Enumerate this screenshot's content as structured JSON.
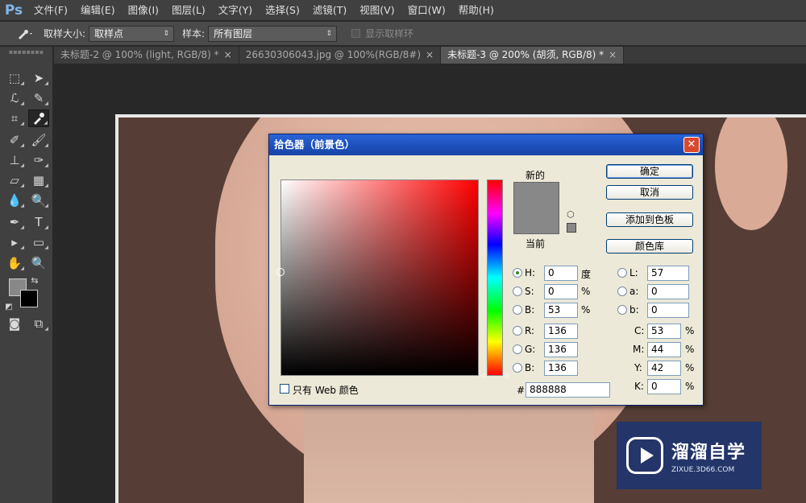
{
  "app": {
    "logo": "Ps"
  },
  "menu": [
    "文件(F)",
    "编辑(E)",
    "图像(I)",
    "图层(L)",
    "文字(Y)",
    "选择(S)",
    "滤镜(T)",
    "视图(V)",
    "窗口(W)",
    "帮助(H)"
  ],
  "options": {
    "sample_size_label": "取样大小:",
    "sample_size_value": "取样点",
    "sample_label": "样本:",
    "sample_value": "所有图层",
    "show_ring_label": "显示取样环"
  },
  "tabs": [
    {
      "label": "未标题-2 @ 100% (light, RGB/8) *",
      "close": "×"
    },
    {
      "label": "26630306043.jpg @ 100%(RGB/8#)",
      "close": "×"
    },
    {
      "label": "未标题-3 @ 200% (胡须, RGB/8) *",
      "close": "×"
    }
  ],
  "colors": {
    "foreground": "#888888",
    "background": "#000000"
  },
  "dialog": {
    "title": "拾色器（前景色）",
    "new_label": "新的",
    "current_label": "当前",
    "buttons": {
      "ok": "确定",
      "cancel": "取消",
      "add_swatch": "添加到色板",
      "libraries": "颜色库"
    },
    "hsb": {
      "h": {
        "label": "H:",
        "value": "0",
        "unit": "度"
      },
      "s": {
        "label": "S:",
        "value": "0",
        "unit": "%"
      },
      "b": {
        "label": "B:",
        "value": "53",
        "unit": "%"
      }
    },
    "rgb": {
      "r": {
        "label": "R:",
        "value": "136"
      },
      "g": {
        "label": "G:",
        "value": "136"
      },
      "b": {
        "label": "B:",
        "value": "136"
      }
    },
    "lab": {
      "l": {
        "label": "L:",
        "value": "57"
      },
      "a": {
        "label": "a:",
        "value": "0"
      },
      "b": {
        "label": "b:",
        "value": "0"
      }
    },
    "cmyk": {
      "c": {
        "label": "C:",
        "value": "53",
        "unit": "%"
      },
      "m": {
        "label": "M:",
        "value": "44",
        "unit": "%"
      },
      "y": {
        "label": "Y:",
        "value": "42",
        "unit": "%"
      },
      "k": {
        "label": "K:",
        "value": "0",
        "unit": "%"
      }
    },
    "hex_label": "#",
    "hex_value": "888888",
    "web_only_label": "只有 Web 颜色"
  },
  "watermark": {
    "title": "溜溜自学",
    "url": "ZIXUE.3D66.COM"
  }
}
